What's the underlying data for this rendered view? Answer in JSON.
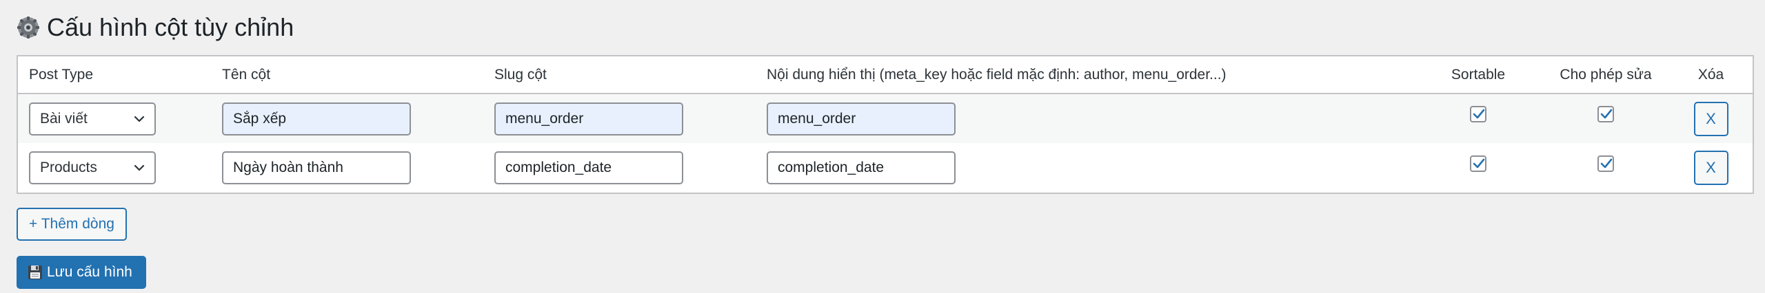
{
  "title": "Cấu hình cột tùy chỉnh",
  "table": {
    "headers": {
      "post_type": "Post Type",
      "column_name": "Tên cột",
      "slug": "Slug cột",
      "content": "Nội dung hiển thị (meta_key hoặc field mặc định: author, menu_order...)",
      "sortable": "Sortable",
      "editable": "Cho phép sửa",
      "delete": "Xóa"
    },
    "rows": [
      {
        "post_type": "Bài viết",
        "column_name": "Sắp xếp",
        "slug": "menu_order",
        "content": "menu_order",
        "sortable": true,
        "editable": true,
        "delete_label": "X"
      },
      {
        "post_type": "Products",
        "column_name": "Ngày hoàn thành",
        "slug": "completion_date",
        "content": "completion_date",
        "sortable": true,
        "editable": true,
        "delete_label": "X"
      }
    ]
  },
  "buttons": {
    "add_row": "+ Thêm dòng",
    "save": "Lưu cấu hình"
  },
  "colors": {
    "accent": "#2271b1",
    "background": "#f0f0f1",
    "autofill": "#e8f0fe"
  }
}
